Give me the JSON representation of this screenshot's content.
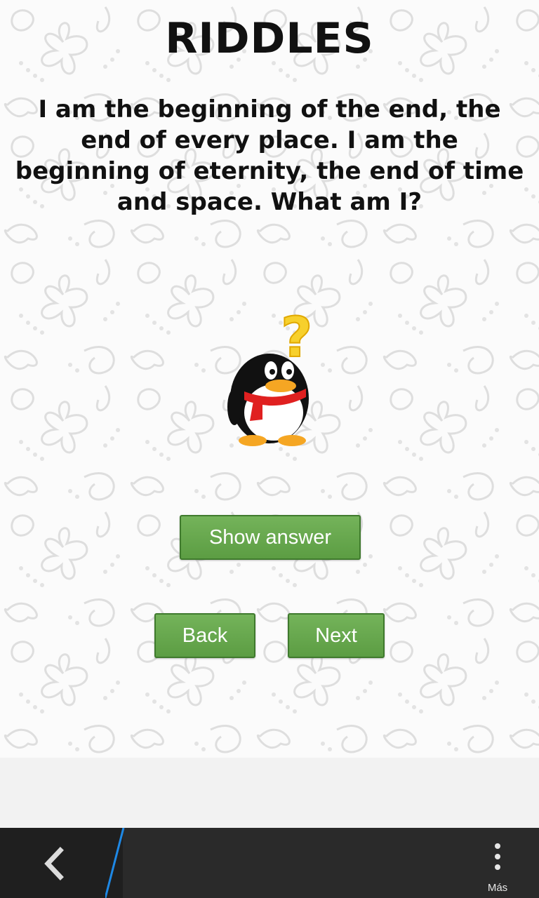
{
  "header": {
    "title": "RIDDLES"
  },
  "riddle": {
    "text": "I am the beginning of the end, the end of every place. I am the beginning of eternity, the end of time and space. What am I?"
  },
  "mascot": {
    "icon": "thinking-penguin-icon",
    "question_mark": "?"
  },
  "buttons": {
    "show_answer": "Show answer",
    "back": "Back",
    "next": "Next"
  },
  "navbar": {
    "back_icon": "chevron-left-icon",
    "more_icon": "more-vertical-icon",
    "more_label": "Más"
  },
  "colors": {
    "button_green": "#66a64c",
    "navbar_bg": "#2a2a2a",
    "accent_blue": "#1e88e5"
  }
}
